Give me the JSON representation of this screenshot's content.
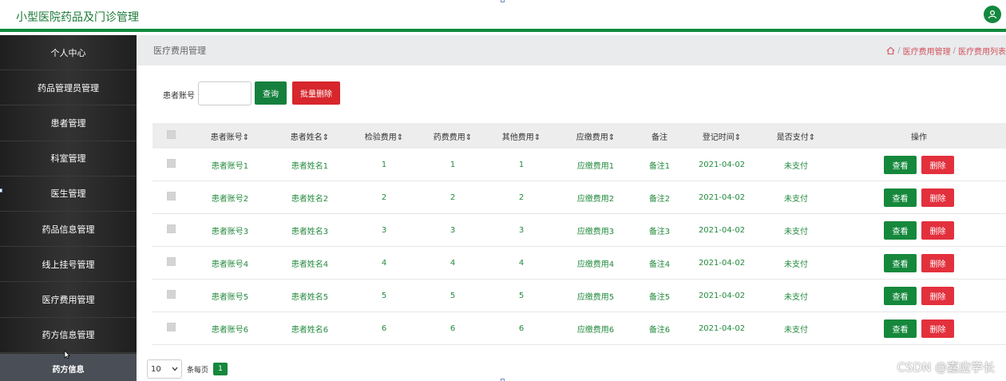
{
  "header": {
    "app_title": "小型医院药品及门诊管理",
    "user_icon": "user-icon"
  },
  "sidebar": {
    "items": [
      {
        "label": "个人中心"
      },
      {
        "label": "药品管理员管理"
      },
      {
        "label": "患者管理"
      },
      {
        "label": "科室管理"
      },
      {
        "label": "医生管理"
      },
      {
        "label": "药品信息管理"
      },
      {
        "label": "线上挂号管理"
      },
      {
        "label": "医疗费用管理"
      },
      {
        "label": "药方信息管理"
      }
    ],
    "sub_item": "药方信息"
  },
  "page": {
    "title": "医疗费用管理",
    "breadcrumb": [
      "医疗费用管理",
      "医疗费用列表"
    ]
  },
  "search": {
    "label": "患者账号",
    "value": "",
    "query_label": "查询",
    "batch_delete_label": "批量删除"
  },
  "table": {
    "headers": [
      "患者账号",
      "患者姓名",
      "检验费用",
      "药费费用",
      "其他费用",
      "应缴费用",
      "备注",
      "登记时间",
      "是否支付",
      "操作"
    ],
    "rows": [
      {
        "account": "患者账号1",
        "name": "患者姓名1",
        "check_fee": "1",
        "drug_fee": "1",
        "other_fee": "1",
        "due": "应缴费用1",
        "note": "备注1",
        "date": "2021-04-02",
        "paid": "未支付"
      },
      {
        "account": "患者账号2",
        "name": "患者姓名2",
        "check_fee": "2",
        "drug_fee": "2",
        "other_fee": "2",
        "due": "应缴费用2",
        "note": "备注2",
        "date": "2021-04-02",
        "paid": "未支付"
      },
      {
        "account": "患者账号3",
        "name": "患者姓名3",
        "check_fee": "3",
        "drug_fee": "3",
        "other_fee": "3",
        "due": "应缴费用3",
        "note": "备注3",
        "date": "2021-04-02",
        "paid": "未支付"
      },
      {
        "account": "患者账号4",
        "name": "患者姓名4",
        "check_fee": "4",
        "drug_fee": "4",
        "other_fee": "4",
        "due": "应缴费用4",
        "note": "备注4",
        "date": "2021-04-02",
        "paid": "未支付"
      },
      {
        "account": "患者账号5",
        "name": "患者姓名5",
        "check_fee": "5",
        "drug_fee": "5",
        "other_fee": "5",
        "due": "应缴费用5",
        "note": "备注5",
        "date": "2021-04-02",
        "paid": "未支付"
      },
      {
        "account": "患者账号6",
        "name": "患者姓名6",
        "check_fee": "6",
        "drug_fee": "6",
        "other_fee": "6",
        "due": "应缴费用6",
        "note": "备注6",
        "date": "2021-04-02",
        "paid": "未支付"
      }
    ],
    "view_label": "查看",
    "delete_label": "删除"
  },
  "pager": {
    "page_size": "10",
    "per_page_label": "条每页",
    "current_page": "1"
  },
  "watermark": "CSDN @嘉应学长",
  "colors": {
    "primary_green": "#15883c",
    "danger_red": "#e3303d",
    "sidebar_bg": "#2d2d2d",
    "header_bar": "#0f8a3c"
  }
}
